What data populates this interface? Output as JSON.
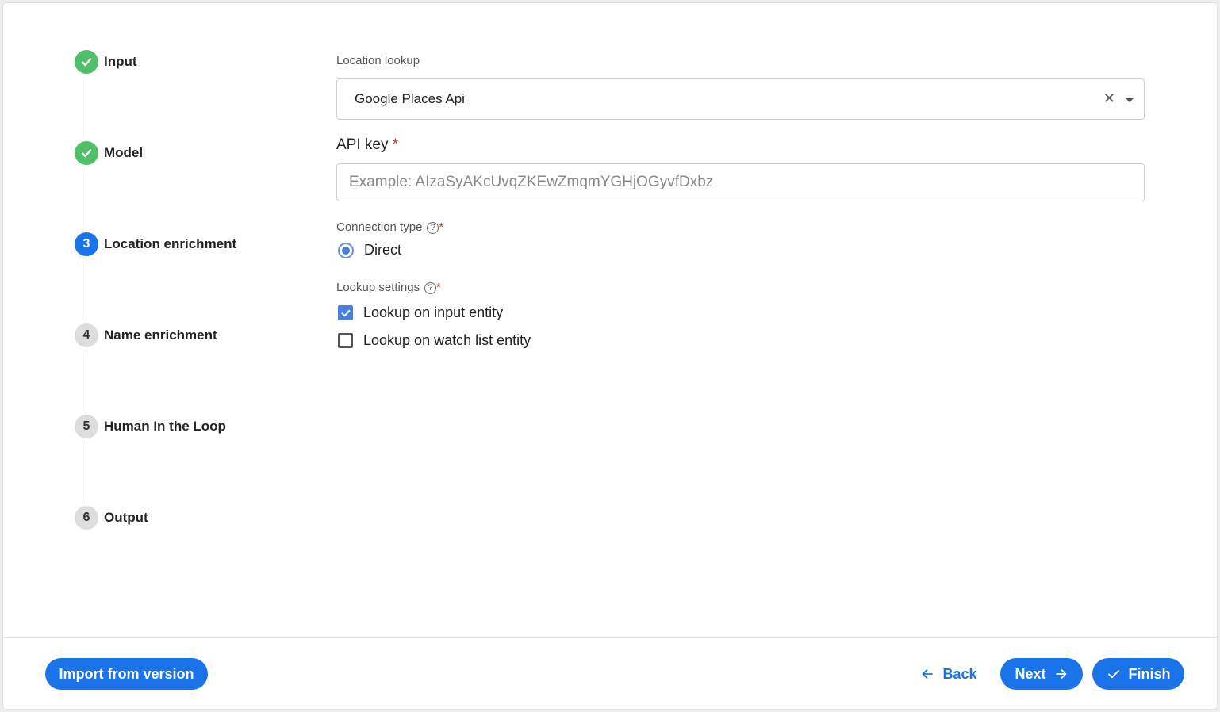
{
  "stepper": {
    "steps": [
      {
        "label": "Input",
        "state": "done",
        "marker": "check-icon"
      },
      {
        "label": "Model",
        "state": "done",
        "marker": "check-icon"
      },
      {
        "label": "Location enrichment",
        "state": "active",
        "number": "3"
      },
      {
        "label": "Name enrichment",
        "state": "pending",
        "number": "4"
      },
      {
        "label": "Human In the Loop",
        "state": "pending",
        "number": "5"
      },
      {
        "label": "Output",
        "state": "pending",
        "number": "6"
      }
    ]
  },
  "form": {
    "location_lookup": {
      "label": "Location lookup",
      "value": "Google Places Api",
      "clear_glyph": "✕"
    },
    "api_key": {
      "label": "API key",
      "required_mark": "*",
      "value": "",
      "placeholder": "Example: AIzaSyAKcUvqZKEwZmqmYGHjOGyvfDxbz"
    },
    "connection_type": {
      "label": "Connection type",
      "required_mark": "*",
      "help_glyph": "?",
      "options": [
        {
          "label": "Direct",
          "selected": true
        }
      ]
    },
    "lookup_settings": {
      "label": "Lookup settings",
      "required_mark": "*",
      "help_glyph": "?",
      "options": [
        {
          "label": "Lookup on input entity",
          "checked": true
        },
        {
          "label": "Lookup on watch list entity",
          "checked": false
        }
      ]
    }
  },
  "footer": {
    "import_label": "Import from version",
    "back_label": "Back",
    "next_label": "Next",
    "finish_label": "Finish"
  },
  "colors": {
    "accent": "#1a73e8",
    "done": "#4fbf6a",
    "pending": "#dddddd",
    "required": "#d32f2f"
  }
}
